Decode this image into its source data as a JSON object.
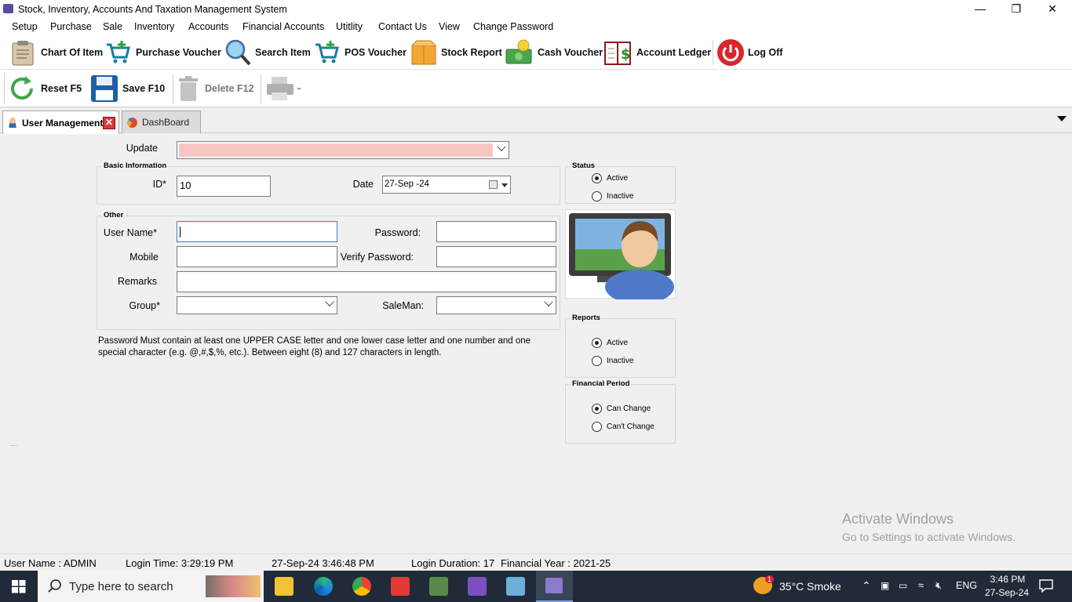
{
  "window": {
    "title": "Stock, Inventory, Accounts And Taxation Management System"
  },
  "menu": [
    "Setup",
    "Purchase",
    "Sale",
    "Inventory",
    "Accounts",
    "Financial Accounts",
    "Utitlity",
    "Contact Us",
    "View",
    "Change Password"
  ],
  "toolbar1": {
    "chart_of_item": "Chart Of Item",
    "purchase_voucher": "Purchase Voucher",
    "search_item": "Search Item",
    "pos_voucher": "POS Voucher",
    "stock_report": "Stock Report",
    "cash_voucher": "Cash Voucher",
    "account_ledger": "Account Ledger",
    "log_off": "Log Off"
  },
  "toolbar2": {
    "reset": "Reset F5",
    "save": "Save F10",
    "delete": "Delete F12"
  },
  "tabs": {
    "user_management": "User Management",
    "dashboard": "DashBoard"
  },
  "form": {
    "update_label": "Update",
    "basic_info_title": "Basic Information",
    "id_label": "ID*",
    "id_value": "10",
    "date_label": "Date",
    "date_value": "27-Sep -24",
    "other_title": "Other",
    "username_label": "User Name*",
    "password_label": "Password:",
    "mobile_label": "Mobile",
    "verify_password_label": "Verify Password:",
    "remarks_label": "Remarks",
    "group_label": "Group*",
    "saleman_label": "SaleMan:",
    "note": "Password Must contain at least one UPPER CASE letter and one lower case letter and one number and one special character (e.g. @,#,$,%, etc.). Between eight (8) and 127 characters in length."
  },
  "status": {
    "title": "Status",
    "active": "Active",
    "inactive": "Inactive",
    "selected": "Active"
  },
  "reports": {
    "title": "Reports",
    "active": "Active",
    "inactive": "Inactive",
    "selected": "Active"
  },
  "financial_period": {
    "title": "Financial Period",
    "can_change": "Can Change",
    "cant_change": "Can't Change",
    "selected": "Can Change"
  },
  "watermark": {
    "line1": "Activate Windows",
    "line2": "Go to Settings to activate Windows."
  },
  "statusbar": {
    "user": "User Name : ADMIN",
    "login_time": "Login Time:   3:29:19 PM",
    "now": "27-Sep-24 3:46:48 PM",
    "duration": "Login Duration: 17",
    "fin_year": "Financial Year : 2021-25"
  },
  "taskbar": {
    "search_placeholder": "Type here to search",
    "weather": "35°C  Smoke",
    "lang": "ENG",
    "time": "3:46 PM",
    "date": "27-Sep-24",
    "badge": "1"
  },
  "colors": {
    "update_highlight": "#f9c4c4",
    "taskbar": "#202a38",
    "logoff": "#d9262c",
    "save": "#1f5fa6"
  }
}
